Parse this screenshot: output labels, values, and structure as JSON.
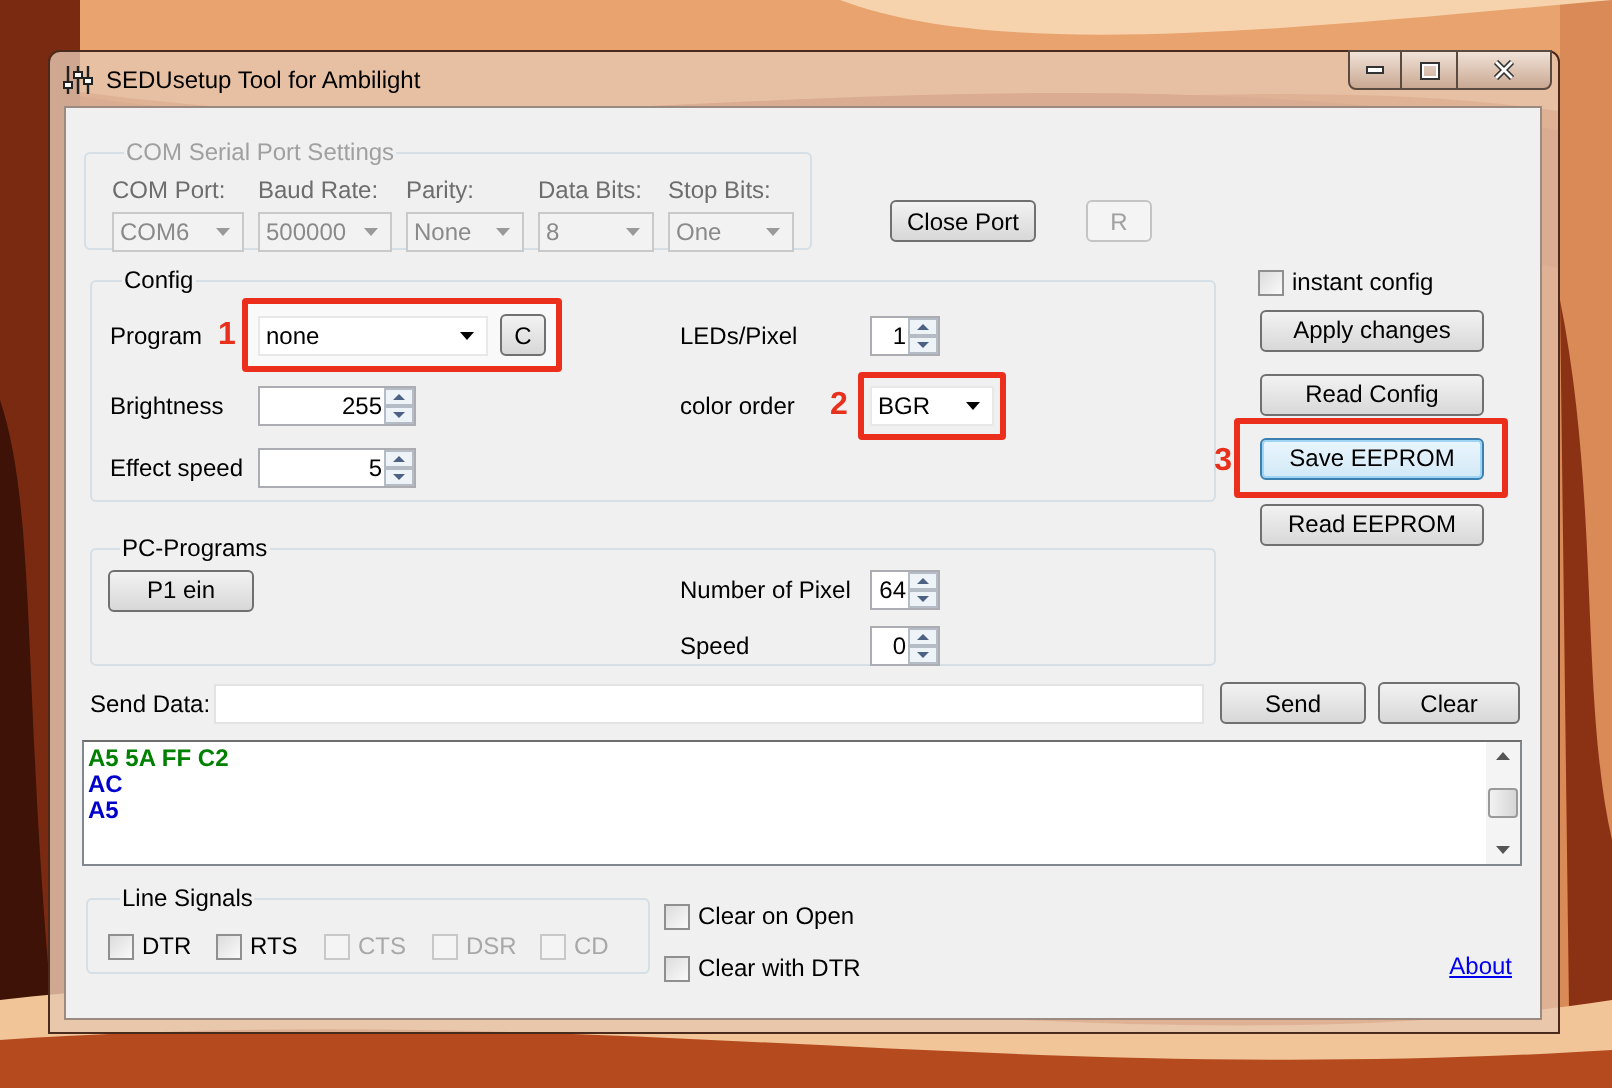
{
  "window": {
    "title": "SEDUsetup Tool for Ambilight"
  },
  "com_settings": {
    "title": "COM Serial Port Settings",
    "disabled": true,
    "fields": [
      {
        "label": "COM Port:",
        "value": "COM6"
      },
      {
        "label": "Baud Rate:",
        "value": "500000"
      },
      {
        "label": "Parity:",
        "value": "None"
      },
      {
        "label": "Data Bits:",
        "value": "8"
      },
      {
        "label": "Stop Bits:",
        "value": "One"
      }
    ]
  },
  "port_buttons": [
    {
      "label": "Close Port",
      "disabled": false
    },
    {
      "label": "R",
      "disabled": true
    }
  ],
  "config": {
    "title": "Config",
    "program": {
      "label": "Program",
      "value": "none",
      "annotation": "1"
    },
    "program_button": "C",
    "brightness": {
      "label": "Brightness",
      "value": "255"
    },
    "effect_speed": {
      "label": "Effect speed",
      "value": "5"
    },
    "leds_per_pixel": {
      "label": "LEDs/Pixel",
      "value": "1"
    },
    "color_order": {
      "label": "color order",
      "value": "BGR",
      "annotation": "2"
    }
  },
  "instant_config": {
    "label": "instant config",
    "checked": false
  },
  "actions": [
    {
      "label": "Apply changes",
      "focused": false
    },
    {
      "label": "Read Config",
      "focused": false
    },
    {
      "label": "Save EEPROM",
      "focused": true,
      "annotation": "3"
    },
    {
      "label": "Read EEPROM",
      "focused": false
    }
  ],
  "pc_programs": {
    "title": "PC-Programs",
    "button": "P1 ein",
    "number_of_pixel": {
      "label": "Number of Pixel",
      "value": "64"
    },
    "speed": {
      "label": "Speed",
      "value": "0"
    }
  },
  "send": {
    "label": "Send Data:",
    "buttons": [
      "Send",
      "Clear"
    ]
  },
  "output": {
    "lines": [
      {
        "text": "A5 5A FF C2",
        "color": "#008000"
      },
      {
        "text": "AC",
        "color": "#0000cc"
      },
      {
        "text": "A5",
        "color": "#0000cc"
      }
    ]
  },
  "line_signals": {
    "title": "Line Signals",
    "items": [
      {
        "label": "DTR",
        "checked": false,
        "disabled": false
      },
      {
        "label": "RTS",
        "checked": false,
        "disabled": false
      },
      {
        "label": "CTS",
        "checked": false,
        "disabled": true
      },
      {
        "label": "DSR",
        "checked": false,
        "disabled": true
      },
      {
        "label": "CD",
        "checked": false,
        "disabled": true
      }
    ]
  },
  "clear_options": [
    {
      "label": "Clear on Open",
      "checked": false
    },
    {
      "label": "Clear with DTR",
      "checked": false
    }
  ],
  "about_link": "About"
}
